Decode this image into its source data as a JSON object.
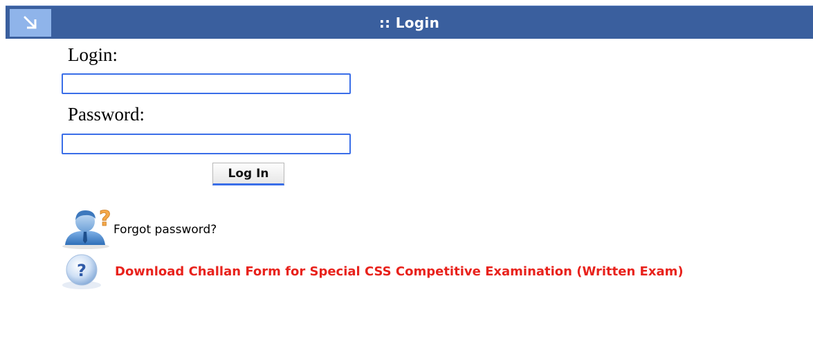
{
  "header": {
    "title": ":: Login",
    "toggle_icon": "arrow-down-right-icon",
    "bar_color": "#3a5f9e",
    "toggle_color": "#8fb4ea"
  },
  "form": {
    "login_label": "Login:",
    "login_value": "",
    "password_label": "Password:",
    "password_value": "",
    "submit_label": "Log In"
  },
  "links": {
    "forgot_password": "Forgot password?",
    "forgot_icon": "user-question-icon",
    "challan_download": "Download Challan Form for Special CSS Competitive Examination (Written Exam)",
    "challan_icon": "help-icon",
    "challan_color": "#e8221c"
  }
}
